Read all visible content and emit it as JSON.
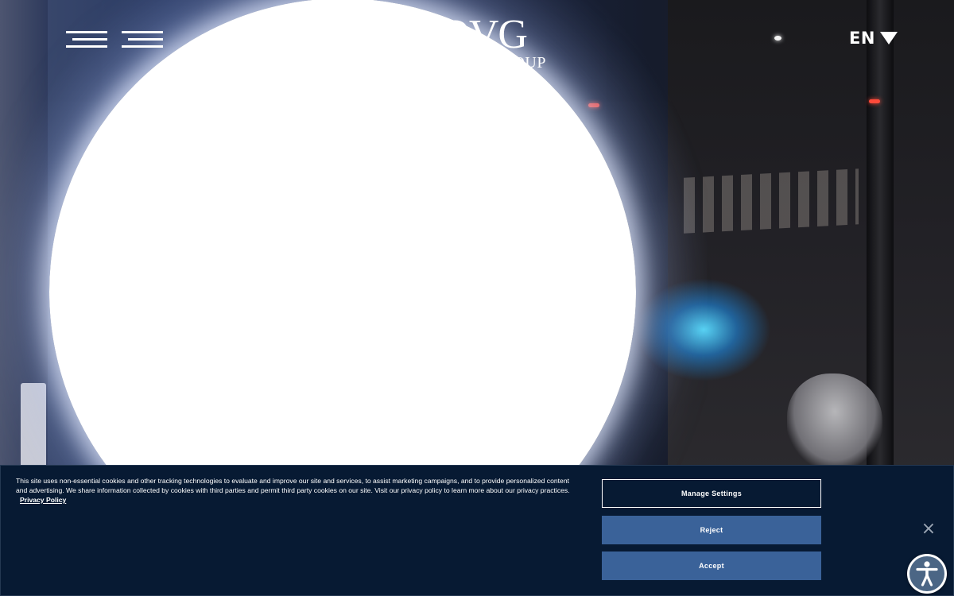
{
  "header": {
    "logo_main": "OVG",
    "logo_sub": "ROUP",
    "language": "EN"
  },
  "cookie_banner": {
    "text": "This site uses non-essential cookies and other tracking technologies to evaluate and improve our site and services, to assist marketing campaigns, and to provide personalized content and advertising. We share information collected by cookies with third parties and permit third party cookies on our site. Visit our privacy policy to learn more about our privacy practices.",
    "privacy_link": "Privacy Policy",
    "manage_label": "Manage Settings",
    "reject_label": "Reject",
    "accept_label": "Accept",
    "close_symbol": "×"
  },
  "colors": {
    "banner_bg": "#071a33",
    "button_blue": "#3a6299",
    "a11y_blue": "#4b6685"
  },
  "icons": {
    "menu": "hamburger-icon",
    "language_caret": "caret-down-icon",
    "close": "close-icon",
    "accessibility": "accessibility-icon"
  }
}
